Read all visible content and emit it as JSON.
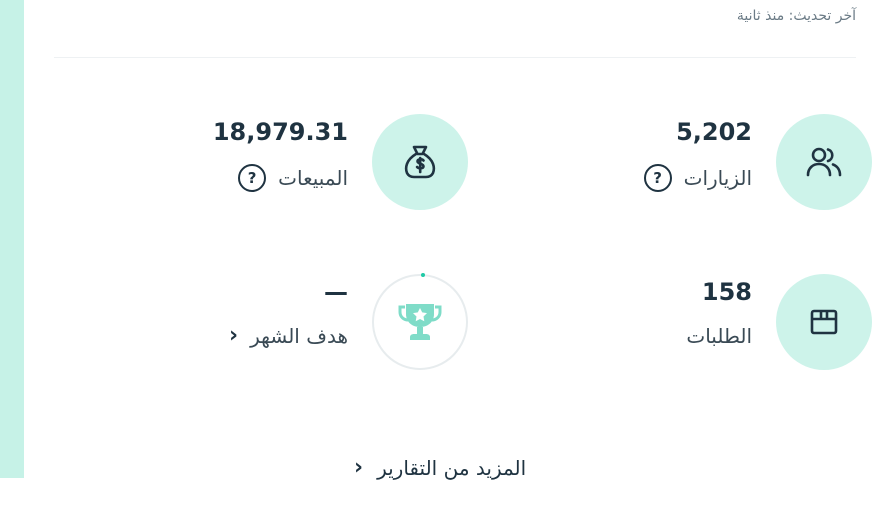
{
  "header": {
    "last_updated": "آخر تحديث: منذ ثانية"
  },
  "stats": {
    "visits": {
      "value": "5,202",
      "label": "الزيارات",
      "help": "?",
      "icon": "users-icon"
    },
    "sales": {
      "value": "18,979.31",
      "label": "المبيعات",
      "help": "?",
      "icon": "money-bag-icon"
    },
    "orders": {
      "value": "158",
      "label": "الطلبات",
      "icon": "box-icon"
    },
    "goal": {
      "value": "—",
      "label": "هدف الشهر",
      "icon": "trophy-icon",
      "progress": 0
    }
  },
  "footer": {
    "more_reports": "المزيد من التقارير",
    "chevron": "›"
  },
  "colors": {
    "accent_bg": "#cdf3ea",
    "accent": "#20c9a6",
    "text": "#1f3341",
    "strip": "#c6f2e7"
  }
}
